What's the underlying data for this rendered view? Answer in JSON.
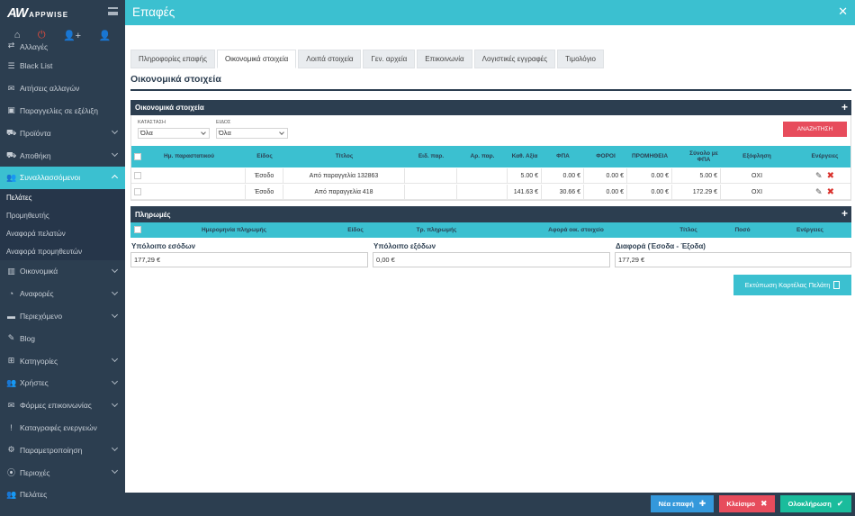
{
  "app": {
    "logo_main": "AW",
    "logo_sub": "APPWISE"
  },
  "topbar": {
    "title": "Επαφές",
    "close": "✕"
  },
  "sidebar": {
    "items": [
      {
        "label": "Αλλαγές",
        "icon": "exchange-icon",
        "glyph": "⇄"
      },
      {
        "label": "Black List",
        "icon": "list-icon",
        "glyph": "☰"
      },
      {
        "label": "Αιτήσεις αλλαγών",
        "icon": "envelope-icon",
        "glyph": "✉"
      },
      {
        "label": "Παραγγελίες σε εξέλιξη",
        "icon": "box-icon",
        "glyph": "▣"
      },
      {
        "label": "Προϊόντα",
        "icon": "cart-icon",
        "glyph": "⛟"
      },
      {
        "label": "Αποθήκη",
        "icon": "truck-icon",
        "glyph": "⛟"
      },
      {
        "label": "Συναλλασσόμενοι",
        "icon": "users-icon",
        "glyph": "👥"
      },
      {
        "label": "Οικονομικά",
        "icon": "bar-chart-icon",
        "glyph": "▥"
      },
      {
        "label": "Αναφορές",
        "icon": "pie-chart-icon",
        "glyph": "◔"
      },
      {
        "label": "Περιεχόμενο",
        "icon": "folder-icon",
        "glyph": "▬"
      },
      {
        "label": "Blog",
        "icon": "pencil-icon",
        "glyph": "✎"
      },
      {
        "label": "Κατηγορίες",
        "icon": "sitemap-icon",
        "glyph": "⊞"
      },
      {
        "label": "Χρήστες",
        "icon": "user-group-icon",
        "glyph": "👥"
      },
      {
        "label": "Φόρμες επικοινωνίας",
        "icon": "envelope-icon",
        "glyph": "✉"
      },
      {
        "label": "Καταγραφές ενεργειών",
        "icon": "exclamation-icon",
        "glyph": "!"
      },
      {
        "label": "Παραμετροποίηση",
        "icon": "cogs-icon",
        "glyph": "⚙"
      },
      {
        "label": "Περιοχές",
        "icon": "map-marker-icon",
        "glyph": "⦿"
      },
      {
        "label": "Πελάτες",
        "icon": "users-icon",
        "glyph": "👥"
      }
    ],
    "subitems": [
      "Πελάτες",
      "Προμηθευτής",
      "Αναφορά πελατών",
      "Αναφορά προμηθευτών"
    ]
  },
  "tabs": [
    "Πληροφορίες επαφής",
    "Οικονομικά στοιχεία",
    "Λοιπά στοιχεία",
    "Γεν. αρχεία",
    "Επικοινωνία",
    "Λογιστικές εγγραφές",
    "Τιμολόγιο"
  ],
  "section_title": "Οικονομικά στοιχεία",
  "economic": {
    "header": "Οικονομικά στοιχεία",
    "plus": "+",
    "filter_status_label": "ΚΑΤΑΣΤΑΣΗ",
    "filter_status_value": "Όλα",
    "filter_type_label": "ΕΙΔΟΣ",
    "filter_type_value": "Όλα",
    "search_button": "ΑΝΑΖΗΤΗΣΗ",
    "columns": [
      "Ημ. παραστατικού",
      "Είδος",
      "Τίτλος",
      "Ειδ. παρ.",
      "Αρ. παρ.",
      "Καθ. Αξία",
      "ΦΠΑ",
      "ΦΟΡΟΙ",
      "ΠΡΟΜΗΘΕΙΑ",
      "Σύνολο με ΦΠΑ",
      "Εξόφληση",
      "Ενέργειες"
    ],
    "rows": [
      {
        "date": "",
        "type": "Έσοδο",
        "title": "Από παραγγελία 132863",
        "doc_type": "",
        "doc_no": "",
        "net": "5.00 €",
        "vat": "0.00 €",
        "taxes": "0.00 €",
        "commission": "0.00 €",
        "total": "5.00 €",
        "paid": "ΟΧΙ"
      },
      {
        "date": "",
        "type": "Έσοδο",
        "title": "Από παραγγελία 418",
        "doc_type": "",
        "doc_no": "",
        "net": "141.63 €",
        "vat": "30.66 €",
        "taxes": "0.00 €",
        "commission": "0.00 €",
        "total": "172.29 €",
        "paid": "ΟΧΙ"
      }
    ]
  },
  "payments": {
    "header": "Πληρωμές",
    "plus": "+",
    "columns": [
      "Ημερομηνία πληρωμής",
      "Είδος",
      "Τρ. πληρωμής",
      "Αφορά οικ. στοιχείο",
      "Τίτλος",
      "Ποσό",
      "Ενέργειες"
    ]
  },
  "balances": {
    "income_label": "Υπόλοιπο εσόδων",
    "income_value": "177,29 €",
    "expense_label": "Υπόλοιπο εξόδων",
    "expense_value": "0,00 €",
    "diff_label": "Διαφορά (Έσοδα - Έξοδα)",
    "diff_value": "177,29 €"
  },
  "print_button": "Εκτύπωση Καρτέλας Πελάτη",
  "footer": {
    "new_contact": "Νέα επαφή",
    "close": "Κλείσιμο",
    "complete": "Ολοκλήρωση"
  },
  "colors": {
    "accent": "#3bc0d0",
    "dark": "#2c3e50",
    "danger": "#e74c5c",
    "success": "#1abc9c",
    "primary": "#3498db"
  }
}
